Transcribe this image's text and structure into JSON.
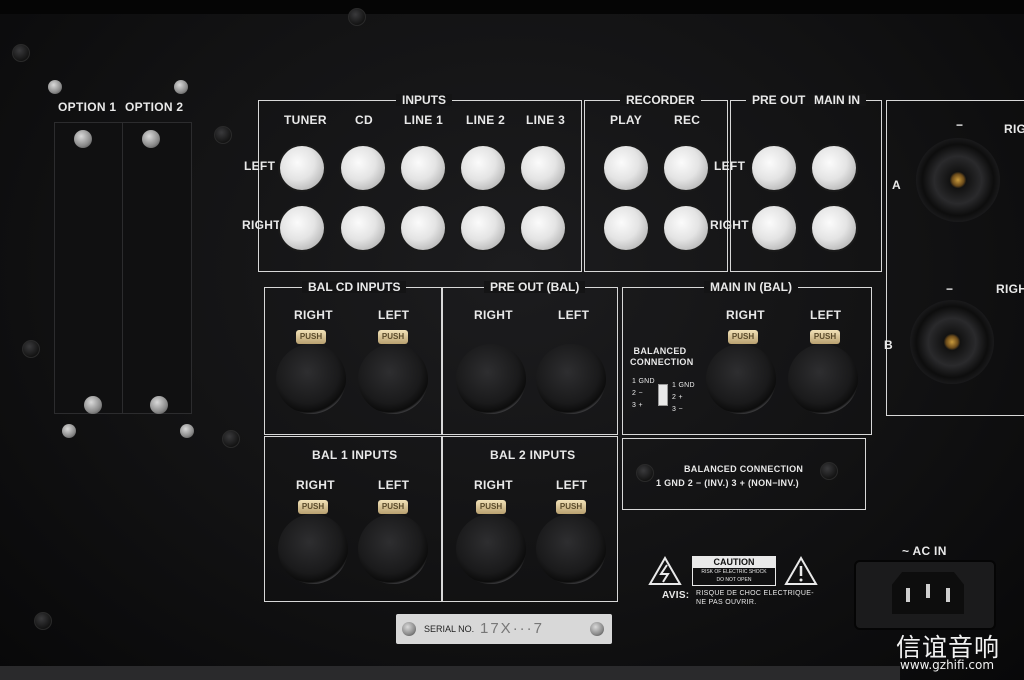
{
  "inputs": {
    "title": "INPUTS",
    "columns": [
      "TUNER",
      "CD",
      "LINE 1",
      "LINE 2",
      "LINE 3"
    ],
    "row_left": "LEFT",
    "row_right": "RIGHT"
  },
  "recorder": {
    "title": "RECORDER",
    "columns": [
      "PLAY",
      "REC"
    ],
    "row_left": "LEFT",
    "row_right": "RIGHT"
  },
  "preout_mainin": {
    "title_a": "PRE OUT",
    "title_b": "MAIN IN"
  },
  "options": {
    "slot1": "OPTION 1",
    "slot2": "OPTION 2"
  },
  "bal_cd": {
    "title": "BAL CD  INPUTS",
    "right": "RIGHT",
    "left": "LEFT"
  },
  "pre_out_bal": {
    "title": "PRE OUT  (BAL)",
    "right": "RIGHT",
    "left": "LEFT"
  },
  "main_in_bal": {
    "title": "MAIN IN  (BAL)",
    "right": "RIGHT",
    "left": "LEFT",
    "balanced_label": "BALANCED CONNECTION",
    "pins_a": [
      "1 GND",
      "2  −",
      "3  +"
    ],
    "pins_b": [
      "1 GND",
      "2  +",
      "3  −"
    ]
  },
  "bal1": {
    "title": "BAL 1  INPUTS",
    "right": "RIGHT",
    "left": "LEFT"
  },
  "bal2": {
    "title": "BAL 2  INPUTS",
    "right": "RIGHT",
    "left": "LEFT"
  },
  "balanced_connection": {
    "title": "BALANCED CONNECTION",
    "pins": "1 GND   2 − (INV.)   3 + (NON−INV.)"
  },
  "push_label": "PUSH",
  "speakers": {
    "minus_a": "−",
    "minus_b": "−",
    "right_a": "RIG",
    "right_b": "RIGH",
    "a": "A",
    "b": "B"
  },
  "caution": {
    "title": "CAUTION",
    "line1": "RISK OF ELECTRIC SHOCK",
    "line2": "DO NOT OPEN",
    "avis": "AVIS:",
    "avis_line1": "RISQUE DE CHOC ELECTRIQUE-",
    "avis_line2": "NE PAS OUVRIR."
  },
  "ac_in": "~ AC IN",
  "serial": {
    "label": "SERIAL NO.",
    "value": "17X···7"
  },
  "watermark": {
    "chinese": "信谊音响",
    "url": "www.gzhifi.com"
  }
}
